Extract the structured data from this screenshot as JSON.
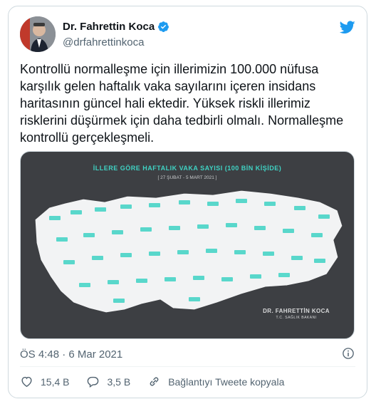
{
  "author": {
    "name": "Dr. Fahrettin Koca",
    "handle": "@drfahrettinkoca"
  },
  "tweet": {
    "text": "Kontrollü normalleşme için illerimizin 100.000 nüfusa karşılık gelen haftalık vaka sayılarını içeren insidans haritasının güncel hali ektedir. Yüksek riskli illerimiz risklerini düşürmek için daha tedbirli olmalı. Normalleşme kontrollü gerçekleşmeli.",
    "timestamp": "ÖS 4:48 · 6 Mar 2021"
  },
  "media": {
    "title": "İLLERE GÖRE HAFTALIK VAKA SAYISI (100 BİN KİŞİDE)",
    "subtitle": "[ 27 ŞUBAT - 5 MART 2021 ]",
    "signature_name": "DR. FAHRETTİN KOCA",
    "signature_title": "T.C. SAĞLIK BAKANI"
  },
  "actions": {
    "likes": "15,4 B",
    "replies": "3,5 B",
    "copy_link": "Bağlantıyı Tweete kopyala"
  },
  "colors": {
    "twitter_blue": "#1d9bf0",
    "map_teal": "#3fd3c4",
    "map_bg": "#3d3f43"
  }
}
